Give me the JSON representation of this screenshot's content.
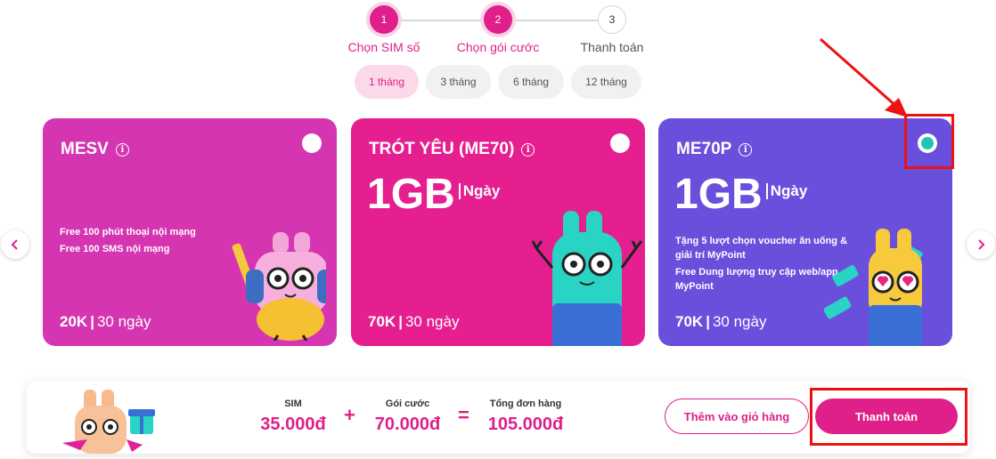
{
  "stepper": {
    "steps": [
      {
        "number": "1",
        "label": "Chọn SIM số",
        "state": "done"
      },
      {
        "number": "2",
        "label": "Chọn gói cước",
        "state": "active"
      },
      {
        "number": "3",
        "label": "Thanh toán",
        "state": "pending"
      }
    ]
  },
  "duration_tabs": [
    {
      "label": "1 tháng",
      "selected": true
    },
    {
      "label": "3 tháng",
      "selected": false
    },
    {
      "label": "6 tháng",
      "selected": false
    },
    {
      "label": "12 tháng",
      "selected": false
    }
  ],
  "carousel": {
    "prev_icon": "chevron-left-icon",
    "next_icon": "chevron-right-icon"
  },
  "plans": [
    {
      "name": "MESV",
      "data_amount": "",
      "data_unit": "",
      "features": [
        "Free 100 phút thoại nội mạng",
        "Free 100 SMS nội mạng"
      ],
      "price": "20K",
      "period": "30 ngày",
      "color": "#d535b0",
      "selected": false
    },
    {
      "name": "TRÓT YÊU (ME70)",
      "data_amount": "1GB",
      "data_unit": "Ngày",
      "features": [],
      "price": "70K",
      "period": "30 ngày",
      "color": "#e51f90",
      "selected": false
    },
    {
      "name": "ME70P",
      "data_amount": "1GB",
      "data_unit": "Ngày",
      "features": [
        "Tặng 5 lượt chọn voucher ăn uống & giải trí MyPoint",
        "Free Dung lượng truy cập web/app MyPoint"
      ],
      "price": "70K",
      "period": "30 ngày",
      "color": "#6a4fdc",
      "selected": true
    }
  ],
  "summary": {
    "sim_label": "SIM",
    "sim_value": "35.000đ",
    "plus": "+",
    "plan_label": "Gói cước",
    "plan_value": "70.000đ",
    "equals": "=",
    "total_label": "Tổng đơn hàng",
    "total_value": "105.000đ",
    "add_to_cart_label": "Thêm vào giỏ hàng",
    "checkout_label": "Thanh toán"
  },
  "colors": {
    "brand": "#df1f8a",
    "selected_radio": "#20c3b4",
    "annotation": "#ee1111"
  }
}
